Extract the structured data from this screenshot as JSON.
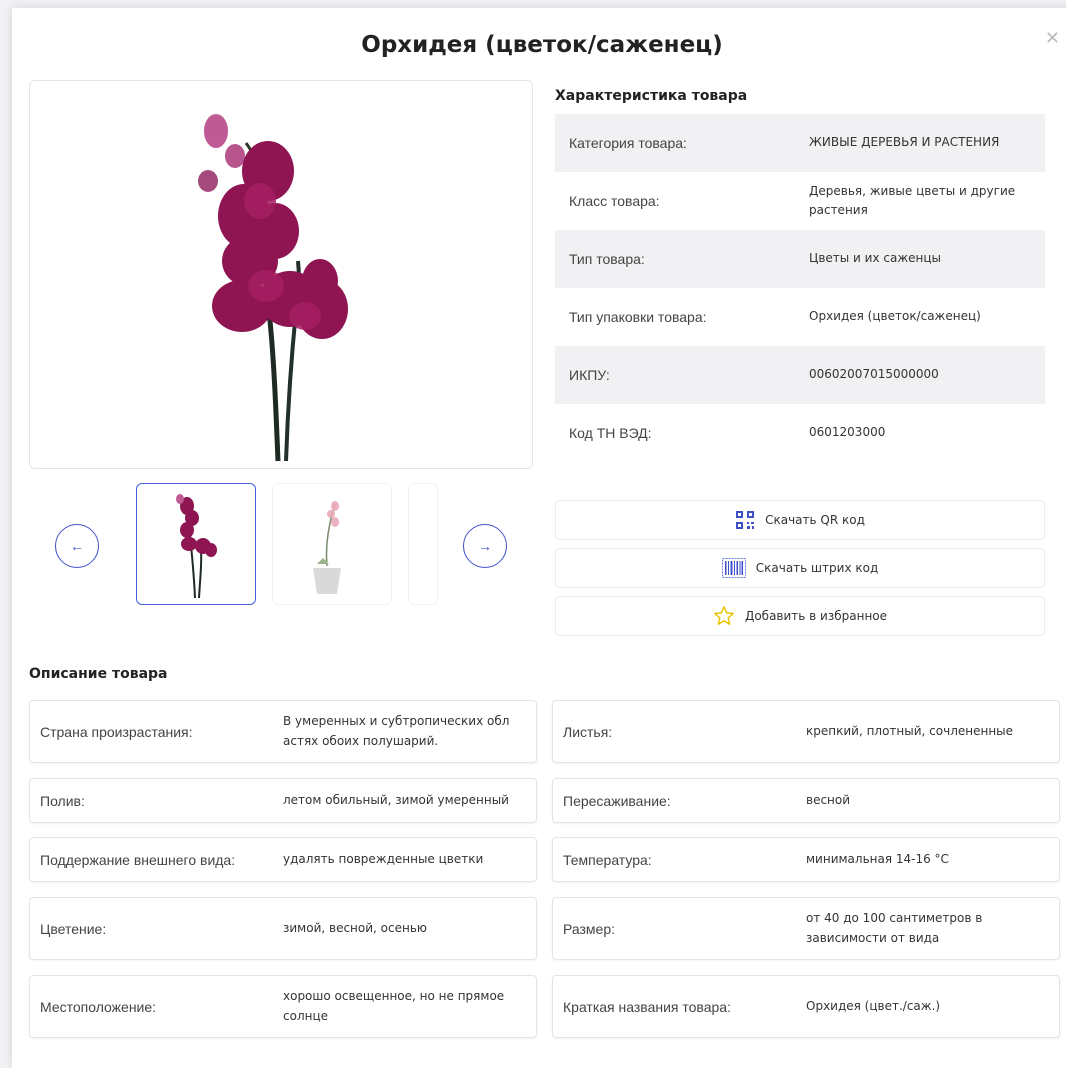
{
  "title": "Орхидея (цветок/саженец)",
  "close_label": "✕",
  "gallery": {
    "prev_label": "←",
    "next_label": "→"
  },
  "specs": {
    "title": "Характеристика товара",
    "rows": [
      {
        "label": "Категория товара:",
        "value": "ЖИВЫЕ ДЕРЕВЬЯ И РАСТЕНИЯ"
      },
      {
        "label": "Класс товара:",
        "value": "Деревья, живые цветы и другие растения"
      },
      {
        "label": "Тип товара:",
        "value": "Цветы и их саженцы"
      },
      {
        "label": "Тип упаковки товара:",
        "value": "Орхидея (цветок/саженец)"
      },
      {
        "label": "ИКПУ:",
        "value": "00602007015000000"
      },
      {
        "label": "Код ТН ВЭД:",
        "value": "0601203000"
      }
    ]
  },
  "actions": {
    "qr_label": "Скачать QR код",
    "barcode_label": "Скачать штрих код",
    "favorite_label": "Добавить в избранное",
    "favorite_color": "#e8c400",
    "icon_color": "#3f51c9"
  },
  "description": {
    "title": "Описание товара",
    "items": [
      {
        "label": "Страна произрастания:",
        "value": "В умеренных и субтропических обл астях обоих полушарий."
      },
      {
        "label": "Листья:",
        "value": "крепкий, плотный, сочлененные"
      },
      {
        "label": "Полив:",
        "value": "летом обильный, зимой умеренный"
      },
      {
        "label": "Пересаживание:",
        "value": "весной"
      },
      {
        "label": "Поддержание внешнего вида:",
        "value": "удалять поврежденные цветки"
      },
      {
        "label": "Температура:",
        "value": "минимальная 14-16 °C"
      },
      {
        "label": "Цветение:",
        "value": "зимой, весной, осенью"
      },
      {
        "label": "Размер:",
        "value": "от 40 до 100 сантиметров в зависимости от вида"
      },
      {
        "label": "Местоположение:",
        "value": "хорошо освещенное, но не прямое солнце"
      },
      {
        "label": "Краткая названия товара:",
        "value": "Орхидея (цвет./саж.)"
      }
    ]
  }
}
